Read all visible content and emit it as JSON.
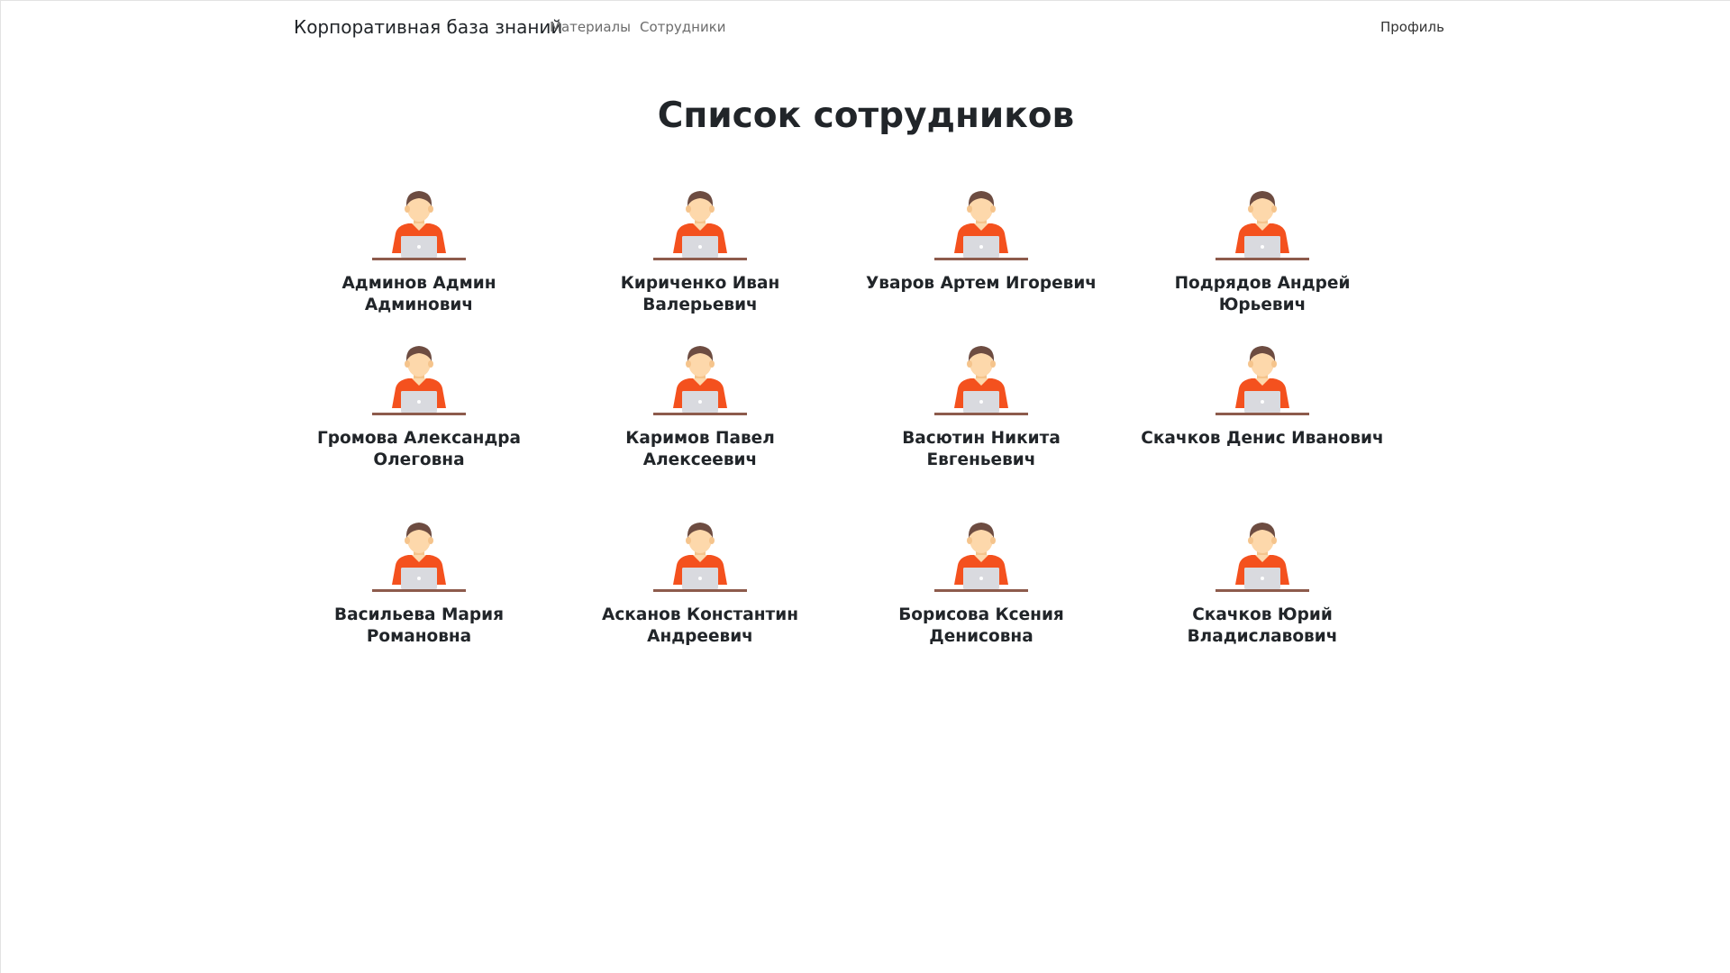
{
  "navbar": {
    "brand": "Корпоративная база знаний",
    "links": [
      {
        "label": "Материалы"
      },
      {
        "label": "Сотрудники"
      }
    ],
    "profile": "Профиль"
  },
  "page": {
    "title": "Список сотрудников"
  },
  "employees": [
    {
      "name": "Админов Админ Админович",
      "icon": "employee-avatar-icon"
    },
    {
      "name": "Кириченко Иван Валерьевич",
      "icon": "employee-avatar-icon"
    },
    {
      "name": "Уваров Артем Игоревич",
      "icon": "employee-avatar-icon"
    },
    {
      "name": "Подрядов Андрей Юрьевич",
      "icon": "employee-avatar-icon"
    },
    {
      "name": "Громова Александра Олеговна",
      "icon": "employee-avatar-icon"
    },
    {
      "name": "Каримов Павел Алексеевич",
      "icon": "employee-avatar-icon"
    },
    {
      "name": "Васютин Никита Евгеньевич",
      "icon": "employee-avatar-icon"
    },
    {
      "name": "Скачков Денис Иванович",
      "icon": "employee-avatar-icon"
    },
    {
      "name": "Васильева Мария Романовна",
      "icon": "employee-avatar-icon"
    },
    {
      "name": "Асканов Константин Андреевич",
      "icon": "employee-avatar-icon"
    },
    {
      "name": "Борисова Ксения Денисовна",
      "icon": "employee-avatar-icon"
    },
    {
      "name": "Скачков Юрий Владиславович",
      "icon": "employee-avatar-icon"
    }
  ],
  "colors": {
    "shirt": "#f4511e",
    "skin": "#fdd8ab",
    "hair": "#6d4c41",
    "laptop": "#d9dadf",
    "desk": "#8d5b4c"
  }
}
